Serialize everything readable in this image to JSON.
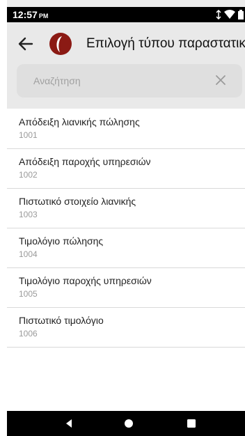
{
  "status": {
    "time": "12:57",
    "ampm": "PM"
  },
  "appbar": {
    "title": "Επιλογή τύπου παραστατικού"
  },
  "search": {
    "placeholder": "Αναζήτηση"
  },
  "items": [
    {
      "label": "Απόδειξη λιανικής πώλησης",
      "code": "1001"
    },
    {
      "label": "Απόδειξη παροχής υπηρεσιών",
      "code": "1002"
    },
    {
      "label": "Πιστωτικό στοιχείο λιανικής",
      "code": "1003"
    },
    {
      "label": "Τιμολόγιο πώλησης",
      "code": "1004"
    },
    {
      "label": "Τιμολόγιο παροχής υπηρεσιών",
      "code": "1005"
    },
    {
      "label": "Πιστωτικό τιμολόγιο",
      "code": "1006"
    }
  ],
  "icons": {
    "back": "arrow-back-icon",
    "logo": "app-logo-icon",
    "clear": "close-icon",
    "wifi": "wifi-icon",
    "signal": "signal-icon",
    "battery": "battery-icon",
    "nav_back": "nav-back-icon",
    "nav_home": "nav-home-icon",
    "nav_recent": "nav-recent-icon"
  },
  "colors": {
    "logo": "#8b1a14",
    "background": "#ececec",
    "list_background": "#ffffff"
  }
}
